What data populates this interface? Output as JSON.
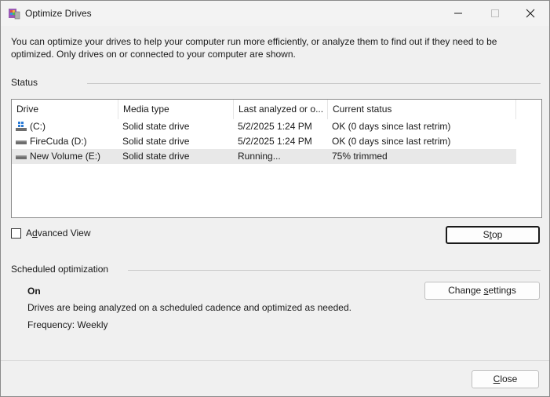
{
  "window": {
    "title": "Optimize Drives"
  },
  "intro": "You can optimize your drives to help your computer run more efficiently, or analyze them to find out if they need to be optimized. Only drives on or connected to your computer are shown.",
  "status": {
    "label": "Status",
    "columns": [
      "Drive",
      "Media type",
      "Last analyzed or o...",
      "Current status"
    ],
    "rows": [
      {
        "drive": "(C:)",
        "media": "Solid state drive",
        "last": "5/2/2025 1:24 PM",
        "status": "OK (0 days since last retrim)",
        "icon": "windows-drive-icon"
      },
      {
        "drive": "FireCuda (D:)",
        "media": "Solid state drive",
        "last": "5/2/2025 1:24 PM",
        "status": "OK (0 days since last retrim)",
        "icon": "drive-icon"
      },
      {
        "drive": "New Volume (E:)",
        "media": "Solid state drive",
        "last": "Running...",
        "status": "75% trimmed",
        "icon": "drive-icon"
      }
    ]
  },
  "advanced_view": {
    "label_pre": "A",
    "label_u": "d",
    "label_post": "vanced View",
    "checked": false
  },
  "stop_button": {
    "pre": "S",
    "u": "t",
    "post": "op"
  },
  "scheduled": {
    "label": "Scheduled optimization",
    "state": "On",
    "description": "Drives are being analyzed on a scheduled cadence and optimized as needed.",
    "frequency": "Frequency: Weekly",
    "change_button": {
      "pre": "Change ",
      "u": "s",
      "post": "ettings"
    }
  },
  "close_button": {
    "u": "C",
    "post": "lose"
  }
}
